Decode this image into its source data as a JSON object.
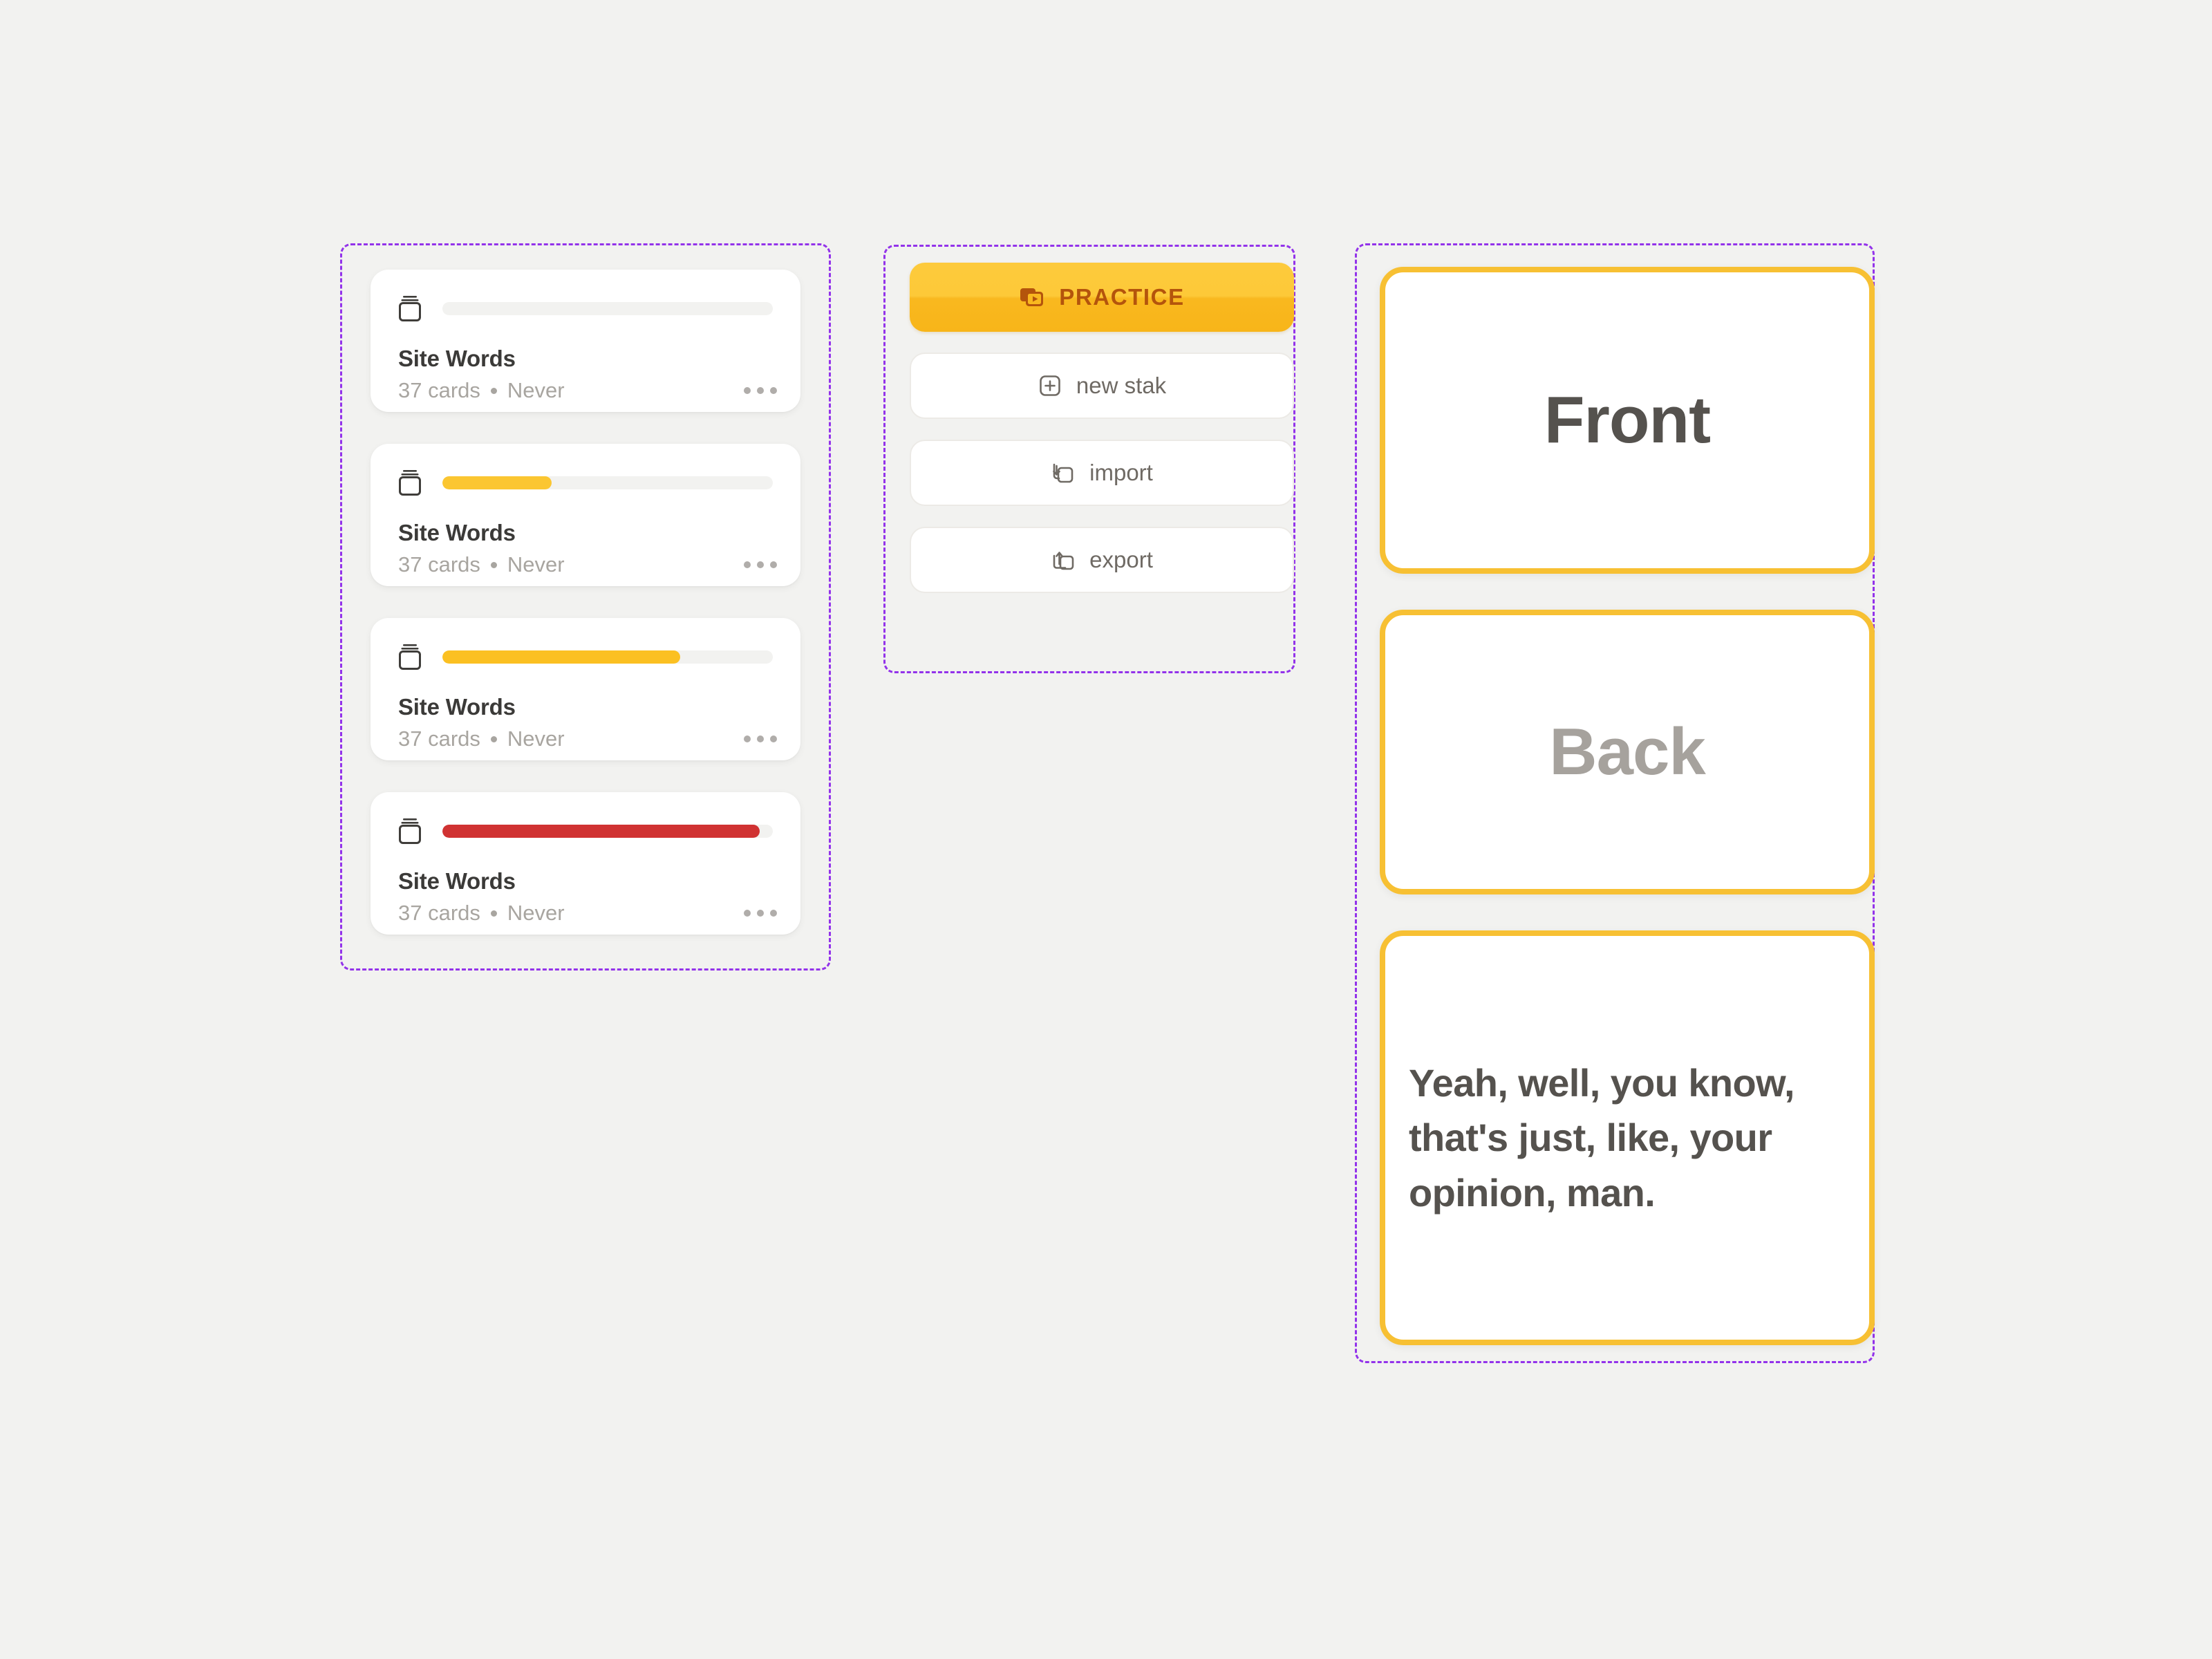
{
  "theme": {
    "background": "#f2f2f0",
    "spec_outline": "#9333ea",
    "accent_yellow": "#f7c033",
    "accent_yellow_light": "#fdca3c",
    "accent_red": "#d03232",
    "practice_text": "#b4540c",
    "text_primary": "#3b3a38",
    "text_muted": "#a8a5a0"
  },
  "stack_list": {
    "region_label": "stack-list-region",
    "cards": [
      {
        "icon": "card-stack-icon",
        "progress_percent": 0,
        "progress_color": "#f2f2f0",
        "title": "Site Words",
        "count": "37 cards",
        "last_practiced": "Never",
        "more_menu": "…"
      },
      {
        "icon": "card-stack-icon",
        "progress_percent": 33,
        "progress_color": "#fbc631",
        "title": "Site Words",
        "count": "37 cards",
        "last_practiced": "Never",
        "more_menu": "…"
      },
      {
        "icon": "card-stack-icon",
        "progress_percent": 72,
        "progress_color": "#fbc022",
        "title": "Site Words",
        "count": "37 cards",
        "last_practiced": "Never",
        "more_menu": "…"
      },
      {
        "icon": "card-stack-icon",
        "progress_percent": 96,
        "progress_color": "#d03232",
        "title": "Site Words",
        "count": "37 cards",
        "last_practiced": "Never",
        "more_menu": "…"
      }
    ]
  },
  "actions": {
    "region_label": "actions-region",
    "practice": {
      "label": "PRACTICE",
      "icon": "play-stack-icon"
    },
    "new_stack": {
      "label": "new stak",
      "icon": "plus-square-icon"
    },
    "import": {
      "label": "import",
      "icon": "import-download-icon"
    },
    "export": {
      "label": "export",
      "icon": "export-upload-icon"
    }
  },
  "preview": {
    "region_label": "preview-region",
    "front_placeholder": "Front",
    "back_placeholder": "Back",
    "filled_card_text": "Yeah, well, you know, that's just, like, your opinion, man."
  }
}
